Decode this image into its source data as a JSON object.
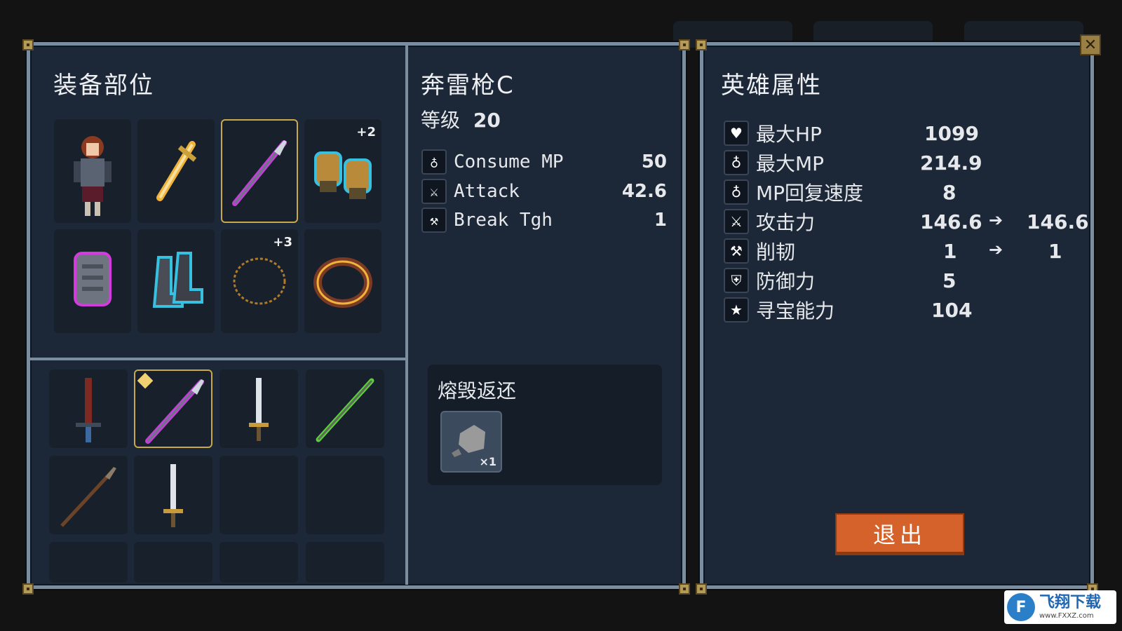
{
  "equipment": {
    "title": "装备部位",
    "slots": [
      {
        "icon": "hero-portrait-icon"
      },
      {
        "icon": "golden-sword-icon"
      },
      {
        "icon": "purple-spear-icon",
        "selected": true
      },
      {
        "icon": "gauntlets-icon",
        "badge": "+2"
      },
      {
        "icon": "chest-armor-icon"
      },
      {
        "icon": "boots-icon"
      },
      {
        "icon": "chain-necklace-icon",
        "badge": "+3"
      },
      {
        "icon": "ring-icon"
      }
    ]
  },
  "inventory": {
    "items": [
      {
        "icon": "red-sword-icon"
      },
      {
        "icon": "purple-spear-icon",
        "selected": true,
        "new": true
      },
      {
        "icon": "short-sword-icon"
      },
      {
        "icon": "green-spear-icon"
      },
      {
        "icon": "brown-spear-icon"
      },
      {
        "icon": "short-sword-icon"
      },
      {
        "icon": "empty-slot"
      },
      {
        "icon": "empty-slot"
      }
    ]
  },
  "weapon": {
    "name": "奔雷枪C",
    "level_label": "等级",
    "level_value": "20",
    "stats": [
      {
        "icon": "potion-icon",
        "label": "Consume MP",
        "value": "50"
      },
      {
        "icon": "sword-icon",
        "label": "Attack",
        "value": "42.6"
      },
      {
        "icon": "hammer-icon",
        "label": "Break Tgh",
        "value": "1"
      }
    ],
    "smelt": {
      "title": "熔毁返还",
      "item_icon": "stone-ore-icon",
      "qty": "×1"
    }
  },
  "hero": {
    "title": "英雄属性",
    "stats": [
      {
        "icon": "heart-icon",
        "label": "最大HP",
        "value": "1099"
      },
      {
        "icon": "potion-icon",
        "label": "最大MP",
        "value": "214.9"
      },
      {
        "icon": "potion-regen-icon",
        "label": "MP回复速度",
        "value": "8"
      },
      {
        "icon": "sword-icon",
        "label": "攻击力",
        "value": "146.6",
        "new_value": "146.6"
      },
      {
        "icon": "hammer-icon",
        "label": "削韧",
        "value": "1",
        "new_value": "1"
      },
      {
        "icon": "shield-icon",
        "label": "防御力",
        "value": "5"
      },
      {
        "icon": "star-icon",
        "label": "寻宝能力",
        "value": "104"
      }
    ],
    "exit_label": "退出"
  },
  "watermark": {
    "brand": "飞翔下载",
    "url": "www.FXXZ.com",
    "logo": "F"
  },
  "colors": {
    "panel_bg": "#1c2837",
    "border": "#7b8ea1",
    "select": "#c9a84a",
    "exit_button": "#d5622a"
  }
}
